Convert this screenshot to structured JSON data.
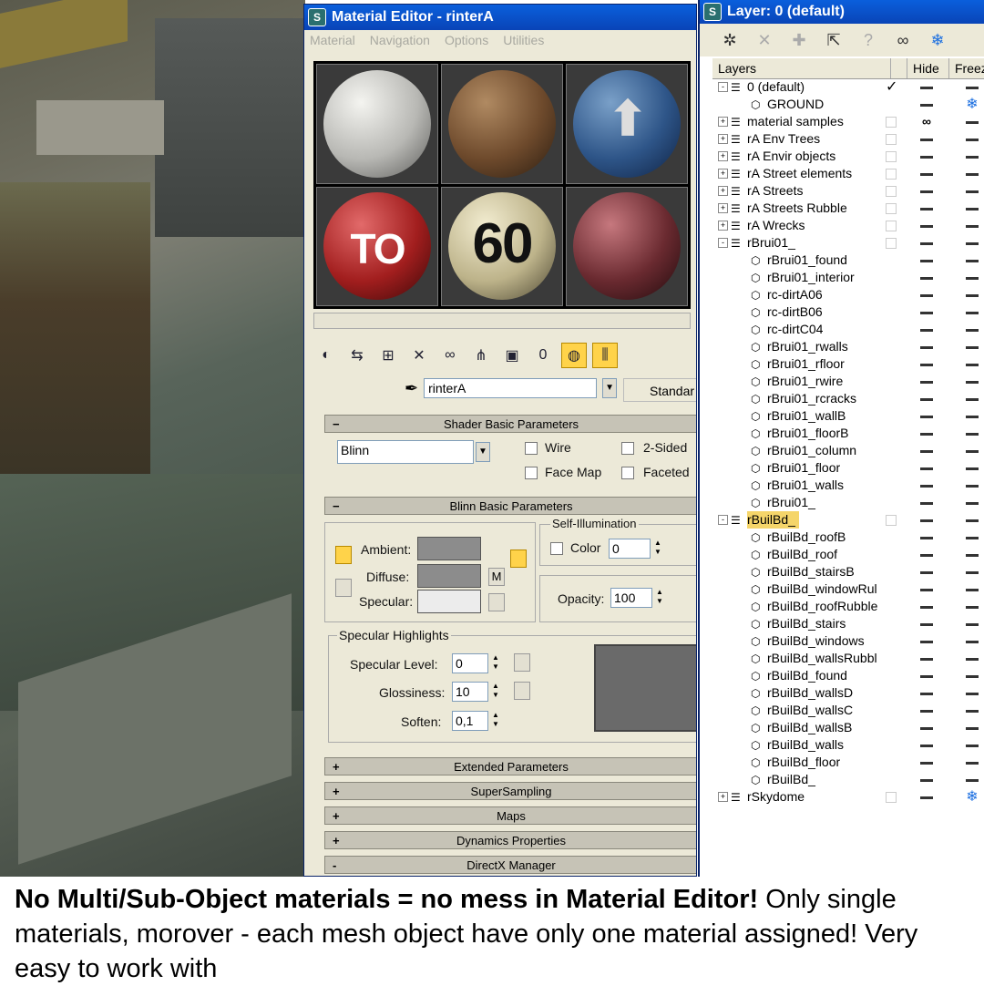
{
  "material_editor": {
    "title": "Material Editor - rinterA",
    "menu": [
      "Material",
      "Navigation",
      "Options",
      "Utilities"
    ],
    "slot_texts": [
      "",
      "",
      "",
      "TO",
      "60",
      ""
    ],
    "material_name": "rinterA",
    "type_button": "Standar",
    "shader_rollout": "Shader Basic Parameters",
    "shader": "Blinn",
    "wire": "Wire",
    "two_sided": "2-Sided",
    "face_map": "Face Map",
    "faceted": "Faceted",
    "blinn_rollout": "Blinn Basic Parameters",
    "self_illum_group": "Self-Illumination",
    "color_label": "Color",
    "color_value": "0",
    "ambient": "Ambient:",
    "diffuse": "Diffuse:",
    "specular": "Specular:",
    "m_btn": "M",
    "opacity_label": "Opacity:",
    "opacity_value": "100",
    "spec_group": "Specular Highlights",
    "spec_level_label": "Specular Level:",
    "spec_level": "0",
    "gloss_label": "Glossiness:",
    "gloss": "10",
    "soften_label": "Soften:",
    "soften": "0,1",
    "rollouts": [
      {
        "sign": "+",
        "label": "Extended Parameters"
      },
      {
        "sign": "+",
        "label": "SuperSampling"
      },
      {
        "sign": "+",
        "label": "Maps"
      },
      {
        "sign": "+",
        "label": "Dynamics Properties"
      },
      {
        "sign": "-",
        "label": "DirectX Manager"
      }
    ]
  },
  "layer_manager": {
    "title": "Layer: 0 (default)",
    "col_layers": "Layers",
    "col_hide": "Hide",
    "col_freeze": "Freez",
    "rows": [
      {
        "name": "0 (default)",
        "level": 0,
        "kind": "layer",
        "expand": "-",
        "check": "✓",
        "hide": "dash",
        "freeze": "dash"
      },
      {
        "name": "GROUND",
        "level": 1,
        "kind": "obj",
        "hide": "dash",
        "freeze": "snow"
      },
      {
        "name": "material samples",
        "level": 0,
        "kind": "layer",
        "expand": "+",
        "hide": "eye",
        "freeze": "dash"
      },
      {
        "name": "rA Env Trees",
        "level": 0,
        "kind": "layer",
        "expand": "+",
        "hide": "dash",
        "freeze": "dash"
      },
      {
        "name": "rA Envir objects",
        "level": 0,
        "kind": "layer",
        "expand": "+",
        "hide": "dash",
        "freeze": "dash"
      },
      {
        "name": "rA Street elements",
        "level": 0,
        "kind": "layer",
        "expand": "+",
        "hide": "dash",
        "freeze": "dash"
      },
      {
        "name": "rA Streets",
        "level": 0,
        "kind": "layer",
        "expand": "+",
        "hide": "dash",
        "freeze": "dash"
      },
      {
        "name": "rA Streets Rubble",
        "level": 0,
        "kind": "layer",
        "expand": "+",
        "hide": "dash",
        "freeze": "dash"
      },
      {
        "name": "rA Wrecks",
        "level": 0,
        "kind": "layer",
        "expand": "+",
        "hide": "dash",
        "freeze": "dash"
      },
      {
        "name": "rBrui01_",
        "level": 0,
        "kind": "layer",
        "expand": "-",
        "hide": "dash",
        "freeze": "dash"
      },
      {
        "name": "rBrui01_found",
        "level": 1,
        "kind": "obj",
        "hide": "dash",
        "freeze": "dash"
      },
      {
        "name": "rBrui01_interior",
        "level": 1,
        "kind": "obj",
        "hide": "dash",
        "freeze": "dash"
      },
      {
        "name": "rc-dirtA06",
        "level": 1,
        "kind": "obj",
        "hide": "dash",
        "freeze": "dash"
      },
      {
        "name": "rc-dirtB06",
        "level": 1,
        "kind": "obj",
        "hide": "dash",
        "freeze": "dash"
      },
      {
        "name": "rc-dirtC04",
        "level": 1,
        "kind": "obj",
        "hide": "dash",
        "freeze": "dash"
      },
      {
        "name": "rBrui01_rwalls",
        "level": 1,
        "kind": "obj",
        "hide": "dash",
        "freeze": "dash"
      },
      {
        "name": "rBrui01_rfloor",
        "level": 1,
        "kind": "obj",
        "hide": "dash",
        "freeze": "dash"
      },
      {
        "name": "rBrui01_rwire",
        "level": 1,
        "kind": "obj",
        "hide": "dash",
        "freeze": "dash"
      },
      {
        "name": "rBrui01_rcracks",
        "level": 1,
        "kind": "obj",
        "hide": "dash",
        "freeze": "dash"
      },
      {
        "name": "rBrui01_wallB",
        "level": 1,
        "kind": "obj",
        "hide": "dash",
        "freeze": "dash"
      },
      {
        "name": "rBrui01_floorB",
        "level": 1,
        "kind": "obj",
        "hide": "dash",
        "freeze": "dash"
      },
      {
        "name": "rBrui01_column",
        "level": 1,
        "kind": "obj",
        "hide": "dash",
        "freeze": "dash"
      },
      {
        "name": "rBrui01_floor",
        "level": 1,
        "kind": "obj",
        "hide": "dash",
        "freeze": "dash"
      },
      {
        "name": "rBrui01_walls",
        "level": 1,
        "kind": "obj",
        "hide": "dash",
        "freeze": "dash"
      },
      {
        "name": "rBrui01_",
        "level": 1,
        "kind": "obj",
        "hide": "dash",
        "freeze": "dash"
      },
      {
        "name": "rBuilBd_",
        "level": 0,
        "kind": "layer",
        "expand": "-",
        "selected": true,
        "hide": "dash",
        "freeze": "dash"
      },
      {
        "name": "rBuilBd_roofB",
        "level": 1,
        "kind": "obj",
        "hide": "dash",
        "freeze": "dash"
      },
      {
        "name": "rBuilBd_roof",
        "level": 1,
        "kind": "obj",
        "hide": "dash",
        "freeze": "dash"
      },
      {
        "name": "rBuilBd_stairsB",
        "level": 1,
        "kind": "obj",
        "hide": "dash",
        "freeze": "dash"
      },
      {
        "name": "rBuilBd_windowRul",
        "level": 1,
        "kind": "obj",
        "hide": "dash",
        "freeze": "dash"
      },
      {
        "name": "rBuilBd_roofRubble",
        "level": 1,
        "kind": "obj",
        "hide": "dash",
        "freeze": "dash"
      },
      {
        "name": "rBuilBd_stairs",
        "level": 1,
        "kind": "obj",
        "hide": "dash",
        "freeze": "dash"
      },
      {
        "name": "rBuilBd_windows",
        "level": 1,
        "kind": "obj",
        "hide": "dash",
        "freeze": "dash"
      },
      {
        "name": "rBuilBd_wallsRubbl",
        "level": 1,
        "kind": "obj",
        "hide": "dash",
        "freeze": "dash"
      },
      {
        "name": "rBuilBd_found",
        "level": 1,
        "kind": "obj",
        "hide": "dash",
        "freeze": "dash"
      },
      {
        "name": "rBuilBd_wallsD",
        "level": 1,
        "kind": "obj",
        "hide": "dash",
        "freeze": "dash"
      },
      {
        "name": "rBuilBd_wallsC",
        "level": 1,
        "kind": "obj",
        "hide": "dash",
        "freeze": "dash"
      },
      {
        "name": "rBuilBd_wallsB",
        "level": 1,
        "kind": "obj",
        "hide": "dash",
        "freeze": "dash"
      },
      {
        "name": "rBuilBd_walls",
        "level": 1,
        "kind": "obj",
        "hide": "dash",
        "freeze": "dash"
      },
      {
        "name": "rBuilBd_floor",
        "level": 1,
        "kind": "obj",
        "hide": "dash",
        "freeze": "dash"
      },
      {
        "name": "rBuilBd_",
        "level": 1,
        "kind": "obj",
        "hide": "dash",
        "freeze": "dash"
      },
      {
        "name": "rSkydome",
        "level": 0,
        "kind": "layer",
        "expand": "+",
        "hide": "dash",
        "freeze": "snow"
      }
    ]
  },
  "caption": {
    "bold": "No Multi/Sub-Object materials = no mess in Material Editor!",
    "rest": " Only single materials, morover - each mesh object have only one material assigned! Very easy to work with"
  },
  "colors": {
    "titlebar": "#0a5fdc",
    "selected_row": "#f5d56a",
    "snowflake": "#1c6fe0"
  }
}
